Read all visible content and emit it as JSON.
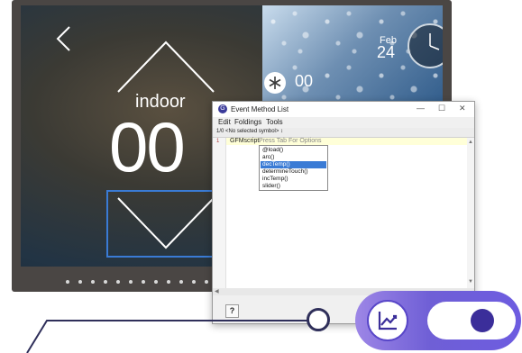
{
  "thermostat": {
    "indoor_label": "indoor",
    "temperature": "00",
    "degree_symbol": "°",
    "cooling_value": "00",
    "date_month": "Feb",
    "date_day": "24"
  },
  "dialog": {
    "title": "Event Method List",
    "menu": [
      "Edit",
      "Foldings",
      "Tools"
    ],
    "symbol_bar": "1/0   <No selected symbol>  ↕",
    "gutter_marker": "1",
    "code_keyword": "GFMscript.",
    "code_hint": "Press Tab For Options",
    "autocomplete_options": [
      "@load()",
      "arc()",
      "decTemp()",
      "determineTouch()",
      "incTemp()",
      "slider()"
    ],
    "selected_option": "decTemp()",
    "help_label": "?"
  },
  "colors": {
    "accent": "#3a7bd5",
    "pill_purple": "#6f5fd6",
    "knob_dark": "#3b2e9a"
  }
}
